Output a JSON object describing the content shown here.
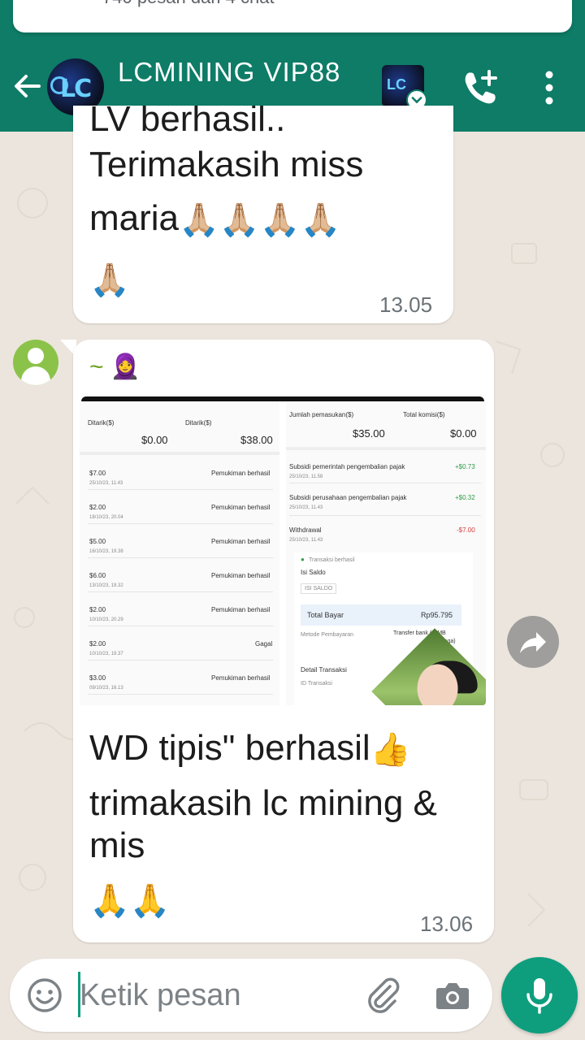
{
  "notification": {
    "text": "740 pesan dari 4 chat"
  },
  "header": {
    "title": "LCMINING VIP88",
    "avatar_text": "LC",
    "accent_color": "#0E7C66",
    "icons": [
      "back-arrow-icon",
      "video-call-icon",
      "add-call-icon",
      "more-vert-icon"
    ]
  },
  "messages": [
    {
      "partial_line": "LV berhasil..",
      "lines": [
        "Terimakasih miss",
        "maria"
      ],
      "emoji_line1": "🙏🏼🙏🏼🙏🏼🙏🏼",
      "emoji_line2": "🙏🏼",
      "time": "13.05"
    },
    {
      "sender": "~ 🧕",
      "screenshot": {
        "left": {
          "header_label_1": "Ditarik($)",
          "header_label_2": "Ditarik($)",
          "header_value_1": "$0.00",
          "header_value_2": "$38.00",
          "rows": [
            {
              "amount": "$7.00",
              "date": "25/10/23, 11.43",
              "status": "Pemukiman berhasil"
            },
            {
              "amount": "$2.00",
              "date": "18/10/23, 20.04",
              "status": "Pemukiman berhasil"
            },
            {
              "amount": "$5.00",
              "date": "16/10/23, 19.38",
              "status": "Pemukiman berhasil"
            },
            {
              "amount": "$6.00",
              "date": "13/10/23, 19.32",
              "status": "Pemukiman berhasil"
            },
            {
              "amount": "$2.00",
              "date": "10/10/23, 20.29",
              "status": "Pemukiman berhasil"
            },
            {
              "amount": "$2.00",
              "date": "10/10/23, 19.37",
              "status": "Gagal"
            },
            {
              "amount": "$3.00",
              "date": "09/10/23, 16.13",
              "status": "Pemukiman berhasil"
            }
          ]
        },
        "right": {
          "header_label_1": "Jumlah pemasukan($)",
          "header_label_2": "Total komisi($)",
          "header_value_1": "$35.00",
          "header_value_2": "$0.00",
          "rows": [
            {
              "label": "Subsidi pemerintah pengembalian pajak",
              "date": "25/10/23, 11.58",
              "value": "+$0.73"
            },
            {
              "label": "Subsidi perusahaan pengembalian pajak",
              "date": "25/10/23, 11.43",
              "value": "+$0.32"
            },
            {
              "label": "Withdrawal",
              "date": "25/10/23, 11.43",
              "value": "-$7.00"
            }
          ],
          "receipt": {
            "success": "Transaksi berhasil",
            "title": "Isi Saldo",
            "tag": "ISI SALDO",
            "total_label": "Total Bayar",
            "total_value": "Rp95.795",
            "method_label": "Metode Pembayaran",
            "method_value_1": "Transfer bank (CIMB",
            "method_value_2": "Niaga)",
            "detail_label": "Detail Transaksi",
            "id_label": "ID Transaksi"
          }
        }
      },
      "lines": [
        "WD tipis\" berhasil",
        "trimakasih lc mining  &",
        "mis"
      ],
      "emoji_thumb": "👍",
      "emoji_line": "🙏🙏",
      "time": "13.06"
    }
  ],
  "composer": {
    "placeholder": "Ketik pesan",
    "icons": [
      "emoji-icon",
      "attach-icon",
      "camera-icon",
      "mic-icon"
    ]
  }
}
